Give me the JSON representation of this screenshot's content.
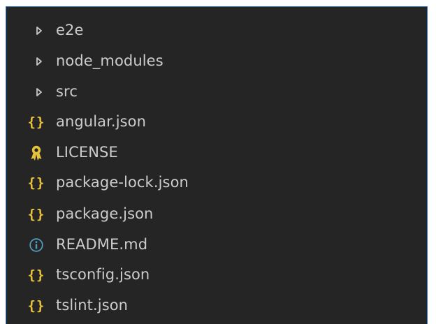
{
  "explorer": {
    "items": [
      {
        "kind": "folder",
        "icon": "chevron-right-icon",
        "name": "e2e"
      },
      {
        "kind": "folder",
        "icon": "chevron-right-icon",
        "name": "node_modules"
      },
      {
        "kind": "folder",
        "icon": "chevron-right-icon",
        "name": "src"
      },
      {
        "kind": "file",
        "icon": "json-braces-icon",
        "icon_glyph": "{}",
        "name": "angular.json"
      },
      {
        "kind": "file",
        "icon": "license-icon",
        "name": "LICENSE"
      },
      {
        "kind": "file",
        "icon": "json-braces-icon",
        "icon_glyph": "{}",
        "name": "package-lock.json"
      },
      {
        "kind": "file",
        "icon": "json-braces-icon",
        "icon_glyph": "{}",
        "name": "package.json"
      },
      {
        "kind": "file",
        "icon": "info-icon",
        "name": "README.md"
      },
      {
        "kind": "file",
        "icon": "json-braces-icon",
        "icon_glyph": "{}",
        "name": "tsconfig.json"
      },
      {
        "kind": "file",
        "icon": "json-braces-icon",
        "icon_glyph": "{}",
        "name": "tslint.json"
      }
    ]
  },
  "colors": {
    "background": "#252526",
    "text": "#cccccc",
    "border_accent": "#2b6fb6",
    "json_icon": "#e8c23a",
    "license_icon": "#e8c23a",
    "info_icon": "#519aba",
    "chevron": "#c5c5c5"
  }
}
